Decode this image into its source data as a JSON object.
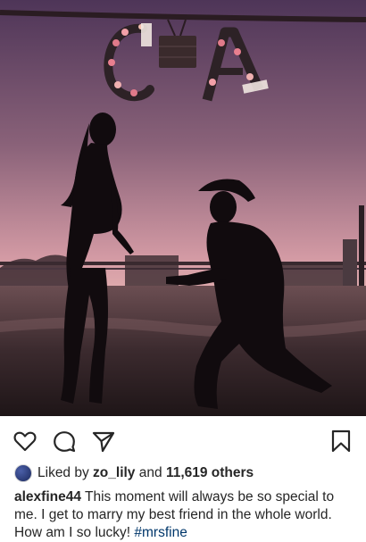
{
  "post": {
    "icons": {
      "like": "heart-icon",
      "comment": "comment-icon",
      "share": "send-icon",
      "save": "bookmark-icon"
    },
    "likes": {
      "prefix": "Liked by",
      "liker": "zo_lily",
      "middle": "and",
      "count": "11,619 others"
    },
    "caption": {
      "username": "alexfine44",
      "text": "This moment will always be so special to me. I get to marry my best friend in the whole world. How am I so lucky!",
      "hashtag": "#mrsfine"
    },
    "photo": {
      "sign_left": "C",
      "sign_right": "A",
      "sky_top": "#5b3f63",
      "sky_bottom": "#d9a3ad"
    }
  }
}
